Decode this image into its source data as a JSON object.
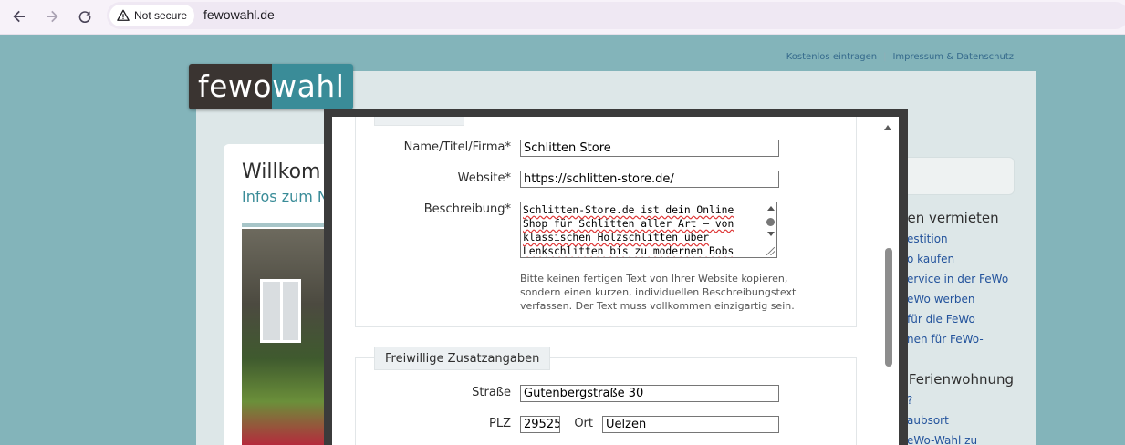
{
  "browser": {
    "security_label": "Not secure",
    "url": "fewowahl.de"
  },
  "site": {
    "logo_left": "fewo",
    "logo_right": "wahl",
    "top_links": [
      "Kostenlos eintragen",
      "Impressum & Datenschutz"
    ],
    "welcome_title": "Willkom",
    "welcome_sub": "Infos zum N"
  },
  "sidebar": {
    "heading1": "gen vermieten",
    "links1": [
      "estition",
      "o kaufen",
      "ervice in der FeWo",
      "eWo werben",
      "für die FeWo",
      "nen für FeWo-"
    ],
    "heading2": "r Ferienwohnung",
    "links2": [
      "?",
      "aubsort",
      "eWo-Wahl zu"
    ]
  },
  "form": {
    "name_label": "Name/Titel/Firma*",
    "name_value": "Schlitten Store",
    "website_label": "Website*",
    "website_value": "https://schlitten-store.de/",
    "desc_label": "Beschreibung*",
    "desc_lines": [
      "Schlitten-Store.de ist dein Online",
      "Shop für Schlitten aller Art – von",
      "klassischen Holzschlitten über",
      "Lenkschlitten bis zu modernen Bobs"
    ],
    "hint": "Bitte keinen fertigen Text von Ihrer Website kopieren, sondern einen kurzen, individuellen Beschreibungstext verfassen. Der Text muss vollkommen einzigartig sein.",
    "optional_legend": "Freiwillige Zusatzangaben",
    "street_label": "Straße",
    "street_value": "Gutenbergstraße 30",
    "plz_label": "PLZ",
    "plz_value": "29525",
    "ort_label": "Ort",
    "ort_value": "Uelzen"
  }
}
